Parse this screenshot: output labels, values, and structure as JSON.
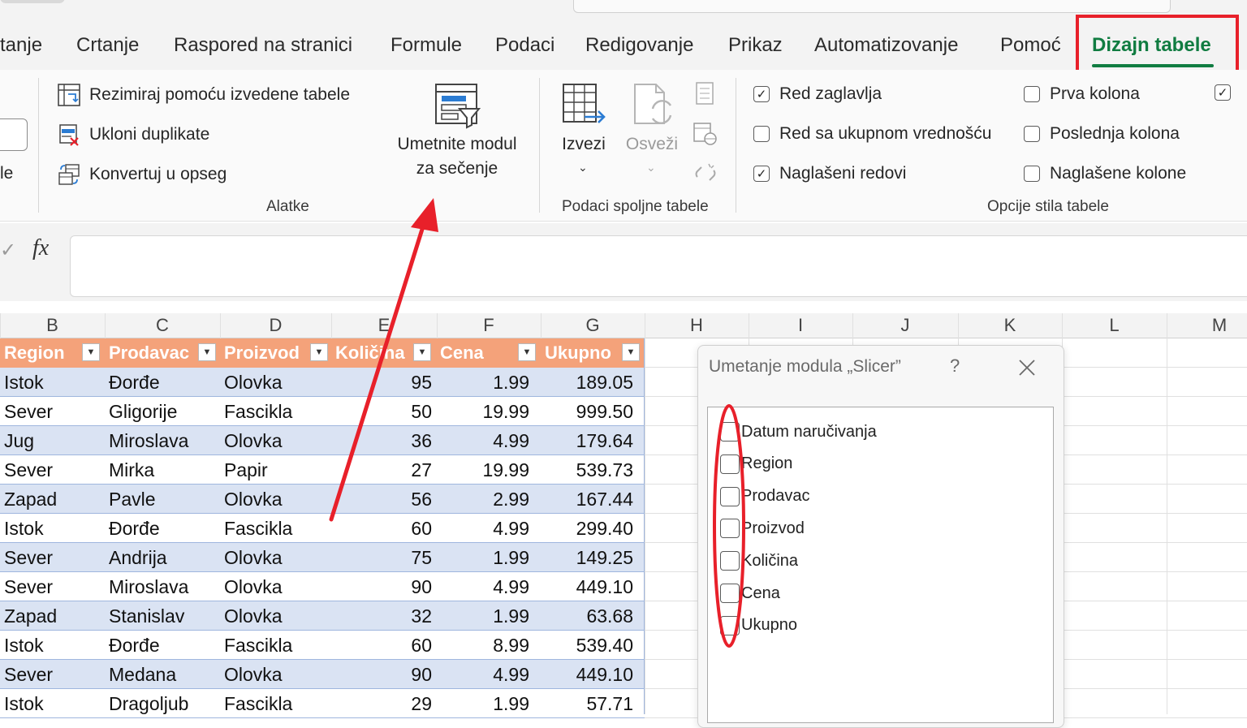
{
  "tabs": [
    {
      "label": "tanje",
      "active": false
    },
    {
      "label": "Crtanje",
      "active": false
    },
    {
      "label": "Raspored na stranici",
      "active": false
    },
    {
      "label": "Formule",
      "active": false
    },
    {
      "label": "Podaci",
      "active": false
    },
    {
      "label": "Redigovanje",
      "active": false
    },
    {
      "label": "Prikaz",
      "active": false
    },
    {
      "label": "Automatizovanje",
      "active": false
    },
    {
      "label": "Pomoć",
      "active": false
    },
    {
      "label": "Dizajn tabele",
      "active": true
    }
  ],
  "ribbon": {
    "left_partial_label": "le",
    "tools": {
      "summarize_pivot": "Rezimiraj pomoću izvedene tabele",
      "remove_duplicates": "Ukloni duplikate",
      "convert_to_range": "Konvertuj u opseg",
      "insert_slicer_line1": "Umetnite modul",
      "insert_slicer_line2": "za sečenje",
      "group_label": "Alatke"
    },
    "external": {
      "export": "Izvezi",
      "refresh": "Osveži",
      "group_label": "Podaci spoljne tabele"
    },
    "style_options": {
      "header_row": {
        "label": "Red zaglavlja",
        "checked": true
      },
      "total_row": {
        "label": "Red sa ukupnom vrednošću",
        "checked": false
      },
      "banded_rows": {
        "label": "Naglašeni redovi",
        "checked": true
      },
      "first_column": {
        "label": "Prva kolona",
        "checked": false
      },
      "last_column": {
        "label": "Poslednja kolona",
        "checked": false
      },
      "banded_columns": {
        "label": "Naglašene kolone",
        "checked": false
      },
      "partial_checked": true,
      "group_label": "Opcije stila tabele"
    }
  },
  "formula_bar": {
    "fx_label": "fx",
    "check_glyph": "✓",
    "value": ""
  },
  "columns": [
    "B",
    "C",
    "D",
    "E",
    "F",
    "G",
    "H",
    "I",
    "J",
    "K",
    "L",
    "M"
  ],
  "table": {
    "headers": [
      "Region",
      "Prodavac",
      "Proizvod",
      "Količina",
      "Cena",
      "Ukupno"
    ],
    "rows": [
      [
        "Istok",
        "Đorđe",
        "Olovka",
        "95",
        "1.99",
        "189.05"
      ],
      [
        "Sever",
        "Gligorije",
        "Fascikla",
        "50",
        "19.99",
        "999.50"
      ],
      [
        "Jug",
        "Miroslava",
        "Olovka",
        "36",
        "4.99",
        "179.64"
      ],
      [
        "Sever",
        "Mirka",
        "Papir",
        "27",
        "19.99",
        "539.73"
      ],
      [
        "Zapad",
        "Pavle",
        "Olovka",
        "56",
        "2.99",
        "167.44"
      ],
      [
        "Istok",
        "Đorđe",
        "Fascikla",
        "60",
        "4.99",
        "299.40"
      ],
      [
        "Sever",
        "Andrija",
        "Olovka",
        "75",
        "1.99",
        "149.25"
      ],
      [
        "Sever",
        "Miroslava",
        "Olovka",
        "90",
        "4.99",
        "449.10"
      ],
      [
        "Zapad",
        "Stanislav",
        "Olovka",
        "32",
        "1.99",
        "63.68"
      ],
      [
        "Istok",
        "Đorđe",
        "Fascikla",
        "60",
        "8.99",
        "539.40"
      ],
      [
        "Sever",
        "Medana",
        "Olovka",
        "90",
        "4.99",
        "449.10"
      ],
      [
        "Istok",
        "Dragoljub",
        "Fascikla",
        "29",
        "1.99",
        "57.71"
      ]
    ]
  },
  "dialog": {
    "title": "Umetanje modula „Slicer”",
    "help": "?",
    "fields": [
      {
        "label": "Datum naručivanja",
        "checked": false
      },
      {
        "label": "Region",
        "checked": false
      },
      {
        "label": "Prodavac",
        "checked": false
      },
      {
        "label": "Proizvod",
        "checked": false
      },
      {
        "label": "Količina",
        "checked": false
      },
      {
        "label": "Cena",
        "checked": false
      },
      {
        "label": "Ukupno",
        "checked": false
      }
    ]
  },
  "colors": {
    "accent_green": "#107c41",
    "annotation_red": "#e8202a",
    "table_header": "#f4a27a",
    "band_row": "#dae3f3"
  }
}
